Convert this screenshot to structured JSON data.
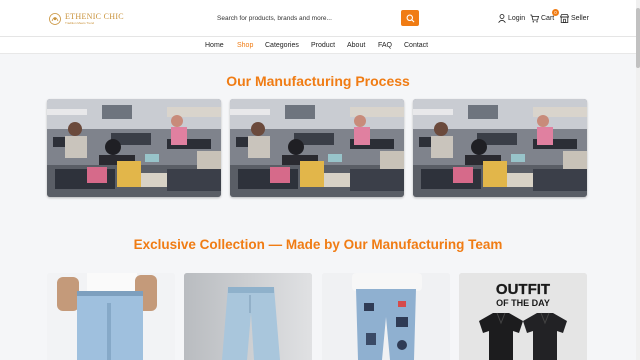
{
  "header": {
    "logo": {
      "title": "ETHENIC CHIC",
      "subtitle": "Tradition Meets Trend"
    },
    "search": {
      "placeholder": "Search for products, brands and more..."
    },
    "login_label": "Login",
    "cart_label": "Cart",
    "cart_count": "0",
    "seller_label": "Seller"
  },
  "nav": {
    "items": [
      "Home",
      "Shop",
      "Categories",
      "Product",
      "About",
      "FAQ",
      "Contact"
    ],
    "active": "Shop"
  },
  "manufacturing": {
    "title": "Our Manufacturing Process"
  },
  "collection": {
    "title": "Exclusive Collection — Made by Our Manufacturing Team",
    "cards": [
      {
        "image": "light-wash-jeans-model"
      },
      {
        "image": "wide-leg-light-denim"
      },
      {
        "image": "patch-print-jeans"
      },
      {
        "image": "outfit-of-the-day-shirts",
        "caption_line1": "OUTFIT",
        "caption_line2": "OF THE DAY"
      }
    ]
  },
  "colors": {
    "accent": "#f07c14",
    "logo": "#c9923a"
  }
}
